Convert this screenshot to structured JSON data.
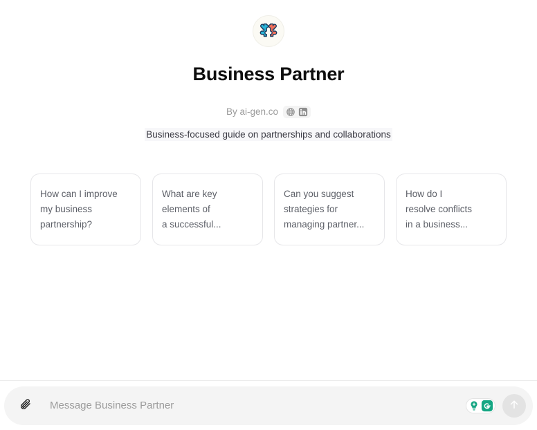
{
  "gpt": {
    "name": "Business Partner",
    "avatar_icon": "puzzle-pieces-icon",
    "byline_prefix": "By ai-gen.co",
    "links": [
      {
        "icon": "globe-icon",
        "name": "website-link"
      },
      {
        "icon": "linkedin-icon",
        "name": "linkedin-link"
      }
    ],
    "description": "Business-focused guide on partnerships and collaborations"
  },
  "suggestions": [
    {
      "text": "How can I improve\nmy business\npartnership?"
    },
    {
      "text": "What are key\nelements of\na successful..."
    },
    {
      "text": "Can you suggest\nstrategies for\nmanaging partner..."
    },
    {
      "text": "How do I\nresolve conflicts\nin a business..."
    }
  ],
  "composer": {
    "attach_icon": "paperclip-icon",
    "placeholder": "Message Business Partner",
    "value": "",
    "grammarly": {
      "lightbulb_icon": "lightbulb-plus-icon",
      "brand_icon": "grammarly-g-icon"
    },
    "send_icon": "arrow-up-icon"
  },
  "colors": {
    "puzzle_left": "#2ab6d9",
    "puzzle_right": "#f4705a",
    "puzzle_outline": "#1b3a5c",
    "avatar_bg": "#fbfaf4",
    "card_border": "#e6e6e9",
    "card_text": "#5d6068",
    "title": "#0d0d0d",
    "byline": "#9b9b9b",
    "composer_bg": "#f4f4f4",
    "grammarly_green": "#15a683",
    "send_bg": "#e3e3e3"
  }
}
